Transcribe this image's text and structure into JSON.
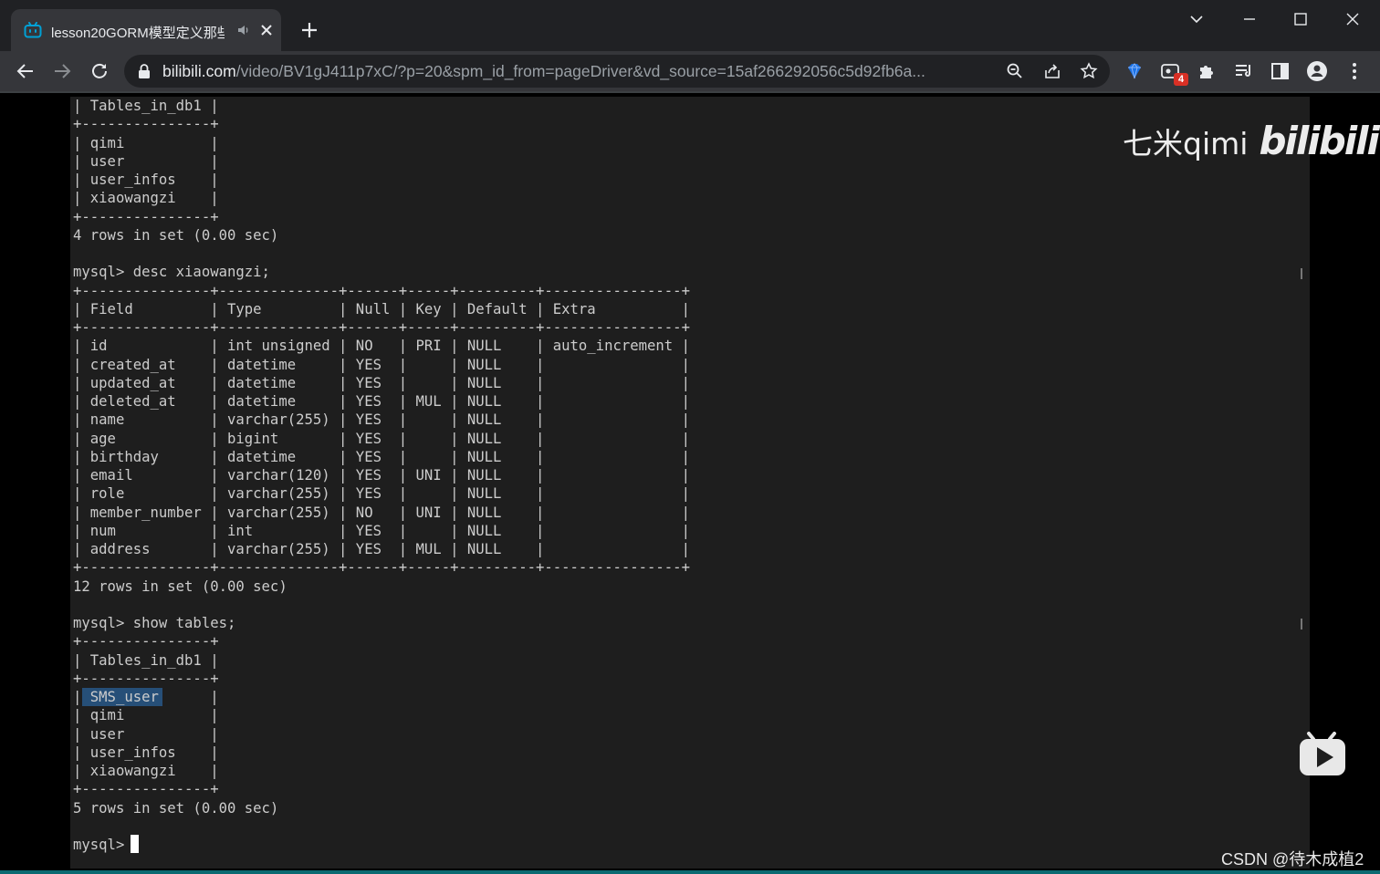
{
  "browser": {
    "tab": {
      "title": "lesson20GORM模型定义那些",
      "favicon": "bilibili-tv-icon",
      "mute_icon": "speaker-icon"
    },
    "address_bar": {
      "host": "bilibili.com",
      "path": "/video/BV1gJ411p7xC/?p=20&spm_id_from=pageDriver&vd_source=15af266292056c5d92fb6a..."
    },
    "extension_badge": "4"
  },
  "terminal": {
    "lines": [
      "| Tables_in_db1 |",
      "+---------------+",
      "| qimi          |",
      "| user          |",
      "| user_infos    |",
      "| xiaowangzi    |",
      "+---------------+",
      "4 rows in set (0.00 sec)",
      "",
      "mysql> desc xiaowangzi;",
      "+---------------+--------------+------+-----+---------+----------------+",
      "| Field         | Type         | Null | Key | Default | Extra          |",
      "+---------------+--------------+------+-----+---------+----------------+",
      "| id            | int unsigned | NO   | PRI | NULL    | auto_increment |",
      "| created_at    | datetime     | YES  |     | NULL    |                |",
      "| updated_at    | datetime     | YES  |     | NULL    |                |",
      "| deleted_at    | datetime     | YES  | MUL | NULL    |                |",
      "| name          | varchar(255) | YES  |     | NULL    |                |",
      "| age           | bigint       | YES  |     | NULL    |                |",
      "| birthday      | datetime     | YES  |     | NULL    |                |",
      "| email         | varchar(120) | YES  | UNI | NULL    |                |",
      "| role          | varchar(255) | YES  |     | NULL    |                |",
      "| member_number | varchar(255) | NO   | UNI | NULL    |                |",
      "| num           | int          | YES  |     | NULL    |                |",
      "| address       | varchar(255) | YES  | MUL | NULL    |                |",
      "+---------------+--------------+------+-----+---------+----------------+",
      "12 rows in set (0.00 sec)",
      "",
      "mysql> show tables;",
      "+---------------+",
      "| Tables_in_db1 |",
      "+---------------+",
      "| SMS_user      |",
      "| qimi          |",
      "| user          |",
      "| user_infos    |",
      "| xiaowangzi    |",
      "+---------------+",
      "5 rows in set (0.00 sec)",
      "",
      "mysql> "
    ],
    "selected_text": "SMS_user"
  },
  "watermark": {
    "author": "七米qimi",
    "site": "bilibili"
  },
  "credit": "CSDN @待木成植2",
  "colors": {
    "terminal_bg": "#1e1e1e",
    "terminal_text": "#cccccc",
    "selection": "#264f78",
    "chrome_dark": "#202124",
    "chrome_toolbar": "#35363a"
  }
}
